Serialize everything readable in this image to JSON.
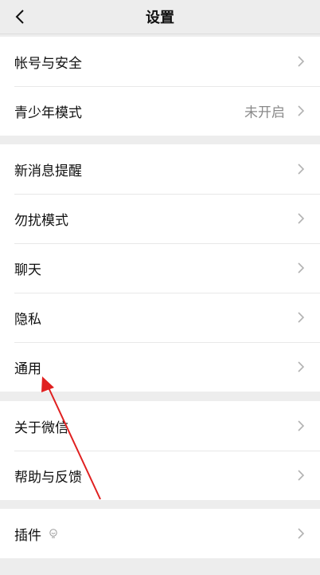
{
  "header": {
    "title": "设置"
  },
  "groups": [
    {
      "items": [
        {
          "label": "帐号与安全"
        },
        {
          "label": "青少年模式",
          "value": "未开启"
        }
      ]
    },
    {
      "items": [
        {
          "label": "新消息提醒"
        },
        {
          "label": "勿扰模式"
        },
        {
          "label": "聊天"
        },
        {
          "label": "隐私"
        },
        {
          "label": "通用"
        }
      ]
    },
    {
      "items": [
        {
          "label": "关于微信"
        },
        {
          "label": "帮助与反馈"
        }
      ]
    },
    {
      "items": [
        {
          "label": "插件"
        }
      ]
    }
  ],
  "colors": {
    "annotation_arrow": "#e02020",
    "background": "#ededed"
  }
}
